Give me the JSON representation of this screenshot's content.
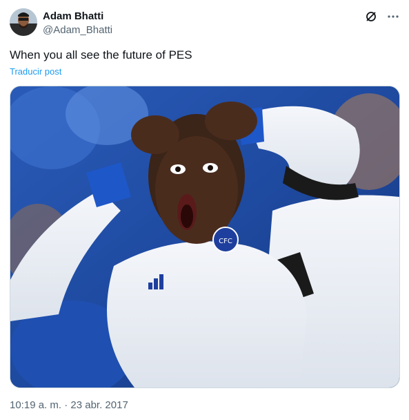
{
  "author": {
    "display_name": "Adam Bhatti",
    "handle": "@Adam_Bhatti"
  },
  "post": {
    "text": "When you all see the future of PES",
    "translate_label": "Traducir post",
    "timestamp": "10:19 a. m. · 23 abr. 2017"
  },
  "icons": {
    "grok": "grok-icon",
    "more": "more-icon"
  },
  "colors": {
    "link": "#1d9bf0",
    "secondary_text": "#536471",
    "text": "#0f1419"
  }
}
